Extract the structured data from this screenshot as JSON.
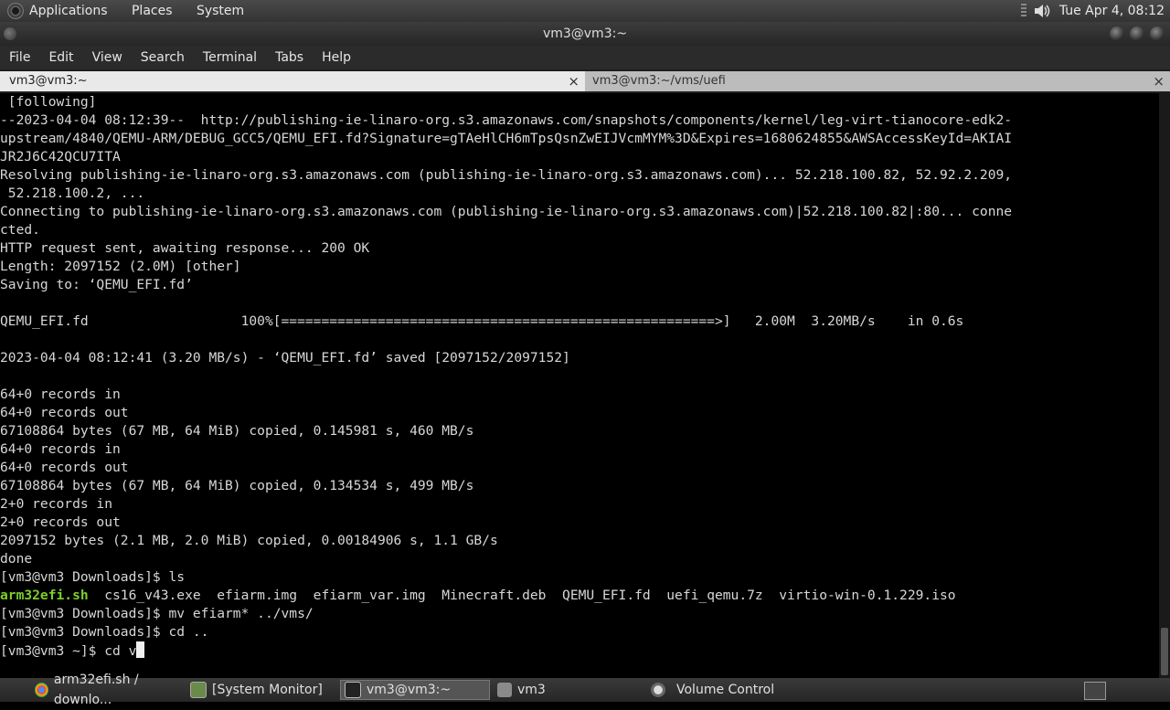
{
  "top_panel": {
    "menus": [
      "Applications",
      "Places",
      "System"
    ],
    "clock": "Tue Apr  4, 08:12"
  },
  "window": {
    "title": "vm3@vm3:~"
  },
  "menubar": [
    "File",
    "Edit",
    "View",
    "Search",
    "Terminal",
    "Tabs",
    "Help"
  ],
  "tabs": [
    {
      "label": "vm3@vm3:~",
      "close": "×"
    },
    {
      "label": "vm3@vm3:~/vms/uefi",
      "close": "×"
    }
  ],
  "terminal": {
    "lines": [
      " [following]",
      "--2023-04-04 08:12:39--  http://publishing-ie-linaro-org.s3.amazonaws.com/snapshots/components/kernel/leg-virt-tianocore-edk2-",
      "upstream/4840/QEMU-ARM/DEBUG_GCC5/QEMU_EFI.fd?Signature=gTAeHlCH6mTpsQsnZwEIJVcmMYM%3D&Expires=1680624855&AWSAccessKeyId=AKIAI",
      "JR2J6C42QCU7ITA",
      "Resolving publishing-ie-linaro-org.s3.amazonaws.com (publishing-ie-linaro-org.s3.amazonaws.com)... 52.218.100.82, 52.92.2.209,",
      " 52.218.100.2, ...",
      "Connecting to publishing-ie-linaro-org.s3.amazonaws.com (publishing-ie-linaro-org.s3.amazonaws.com)|52.218.100.82|:80... conne",
      "cted.",
      "HTTP request sent, awaiting response... 200 OK",
      "Length: 2097152 (2.0M) [other]",
      "Saving to: ‘QEMU_EFI.fd’",
      "",
      "QEMU_EFI.fd                   100%[======================================================>]   2.00M  3.20MB/s    in 0.6s",
      "",
      "2023-04-04 08:12:41 (3.20 MB/s) - ‘QEMU_EFI.fd’ saved [2097152/2097152]",
      "",
      "64+0 records in",
      "64+0 records out",
      "67108864 bytes (67 MB, 64 MiB) copied, 0.145981 s, 460 MB/s",
      "64+0 records in",
      "64+0 records out",
      "67108864 bytes (67 MB, 64 MiB) copied, 0.134534 s, 499 MB/s",
      "2+0 records in",
      "2+0 records out",
      "2097152 bytes (2.1 MB, 2.0 MiB) copied, 0.00184906 s, 1.1 GB/s",
      "done",
      "[vm3@vm3 Downloads]$ ls"
    ],
    "ls_green": "arm32efi.sh",
    "ls_rest": "  cs16_v43.exe  efiarm.img  efiarm_var.img  Minecraft.deb  QEMU_EFI.fd  uefi_qemu.7z  virtio-win-0.1.229.iso",
    "after_lines": [
      "[vm3@vm3 Downloads]$ mv efiarm* ../vms/",
      "[vm3@vm3 Downloads]$ cd .."
    ],
    "prompt_line": "[vm3@vm3 ~]$ cd v"
  },
  "taskbar": [
    {
      "label": "arm32efi.sh / downlo...",
      "icon": "chrome-icon"
    },
    {
      "label": "[System Monitor]",
      "icon": "system-monitor-icon"
    },
    {
      "label": "vm3@vm3:~",
      "icon": "terminal-icon"
    },
    {
      "label": "vm3",
      "icon": "folder-icon"
    },
    {
      "label": "Volume Control",
      "icon": "volume-icon"
    }
  ]
}
